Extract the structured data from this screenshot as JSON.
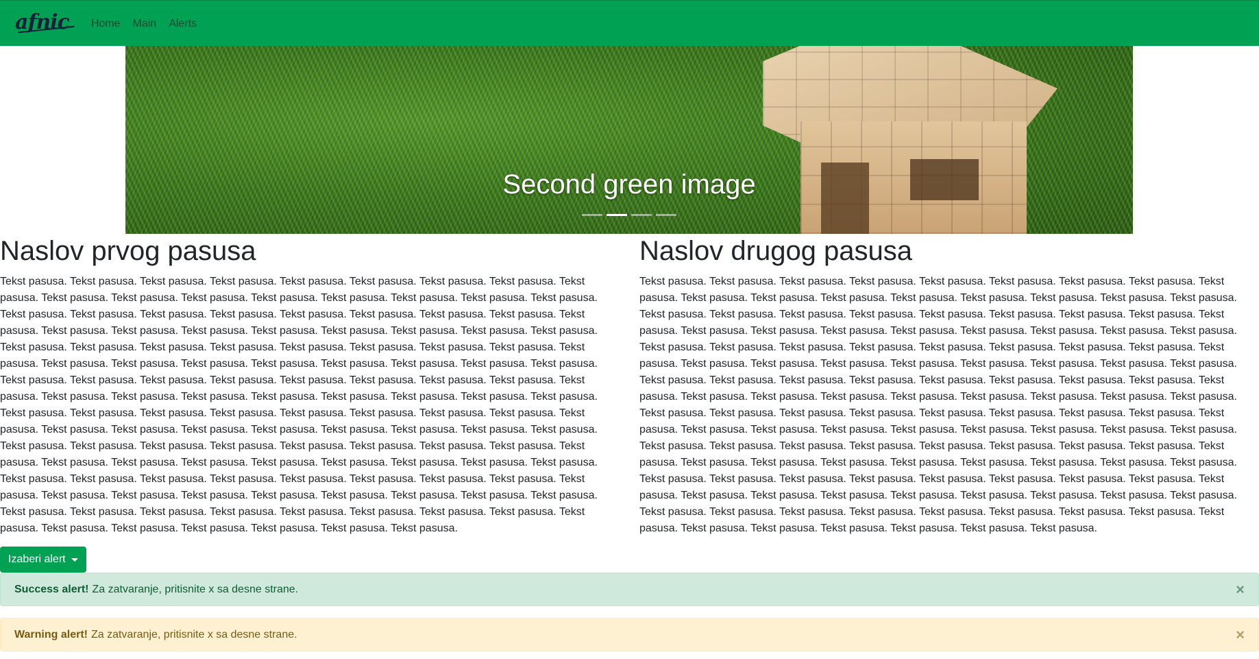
{
  "navbar": {
    "bg_color": "#00a152",
    "brand": "afnic",
    "links": [
      "Home",
      "Main",
      "Alerts"
    ]
  },
  "carousel": {
    "caption": "Second green image",
    "indicator_count": 4,
    "active_index": 1
  },
  "articles": [
    {
      "title": "Naslov prvog pasusa",
      "text": "Tekst pasusa. Tekst pasusa. Tekst pasusa. Tekst pasusa. Tekst pasusa. Tekst pasusa. Tekst pasusa. Tekst pasusa. Tekst pasusa. Tekst pasusa. Tekst pasusa. Tekst pasusa. Tekst pasusa. Tekst pasusa. Tekst pasusa. Tekst pasusa. Tekst pasusa. Tekst pasusa. Tekst pasusa. Tekst pasusa. Tekst pasusa. Tekst pasusa. Tekst pasusa. Tekst pasusa. Tekst pasusa. Tekst pasusa. Tekst pasusa. Tekst pasusa. Tekst pasusa. Tekst pasusa. Tekst pasusa. Tekst pasusa. Tekst pasusa. Tekst pasusa. Tekst pasusa. Tekst pasusa. Tekst pasusa. Tekst pasusa. Tekst pasusa. Tekst pasusa. Tekst pasusa. Tekst pasusa. Tekst pasusa. Tekst pasusa. Tekst pasusa. Tekst pasusa. Tekst pasusa. Tekst pasusa. Tekst pasusa. Tekst pasusa. Tekst pasusa. Tekst pasusa. Tekst pasusa. Tekst pasusa. Tekst pasusa. Tekst pasusa. Tekst pasusa. Tekst pasusa. Tekst pasusa. Tekst pasusa. Tekst pasusa. Tekst pasusa. Tekst pasusa. Tekst pasusa. Tekst pasusa. Tekst pasusa. Tekst pasusa. Tekst pasusa. Tekst pasusa. Tekst pasusa. Tekst pasusa. Tekst pasusa. Tekst pasusa. Tekst pasusa. Tekst pasusa. Tekst pasusa. Tekst pasusa. Tekst pasusa. Tekst pasusa. Tekst pasusa. Tekst pasusa. Tekst pasusa. Tekst pasusa. Tekst pasusa. Tekst pasusa. Tekst pasusa. Tekst pasusa. Tekst pasusa. Tekst pasusa. Tekst pasusa. Tekst pasusa. Tekst pasusa. Tekst pasusa. Tekst pasusa. Tekst pasusa. Tekst pasusa. Tekst pasusa. Tekst pasusa. Tekst pasusa. Tekst pasusa. Tekst pasusa. Tekst pasusa. Tekst pasusa. Tekst pasusa. Tekst pasusa. Tekst pasusa. Tekst pasusa. Tekst pasusa. Tekst pasusa. Tekst pasusa. Tekst pasusa. Tekst pasusa. Tekst pasusa. Tekst pasusa. Tekst pasusa. Tekst pasusa. Tekst pasusa. Tekst pasusa. Tekst pasusa. Tekst pasusa. Tekst pasusa. Tekst pasusa. Tekst pasusa. Tekst pasusa. Tekst pasusa. Tekst pasusa. Tekst pasusa. Tekst pasusa. Tekst pasusa. Tekst pasusa. Tekst pasusa. Tekst pasusa. Tekst pasusa. Tekst pasusa."
    },
    {
      "title": "Naslov drugog pasusa",
      "text": "Tekst pasusa. Tekst pasusa. Tekst pasusa. Tekst pasusa. Tekst pasusa. Tekst pasusa. Tekst pasusa. Tekst pasusa. Tekst pasusa. Tekst pasusa. Tekst pasusa. Tekst pasusa. Tekst pasusa. Tekst pasusa. Tekst pasusa. Tekst pasusa. Tekst pasusa. Tekst pasusa. Tekst pasusa. Tekst pasusa. Tekst pasusa. Tekst pasusa. Tekst pasusa. Tekst pasusa. Tekst pasusa. Tekst pasusa. Tekst pasusa. Tekst pasusa. Tekst pasusa. Tekst pasusa. Tekst pasusa. Tekst pasusa. Tekst pasusa. Tekst pasusa. Tekst pasusa. Tekst pasusa. Tekst pasusa. Tekst pasusa. Tekst pasusa. Tekst pasusa. Tekst pasusa. Tekst pasusa. Tekst pasusa. Tekst pasusa. Tekst pasusa. Tekst pasusa. Tekst pasusa. Tekst pasusa. Tekst pasusa. Tekst pasusa. Tekst pasusa. Tekst pasusa. Tekst pasusa. Tekst pasusa. Tekst pasusa. Tekst pasusa. Tekst pasusa. Tekst pasusa. Tekst pasusa. Tekst pasusa. Tekst pasusa. Tekst pasusa. Tekst pasusa. Tekst pasusa. Tekst pasusa. Tekst pasusa. Tekst pasusa. Tekst pasusa. Tekst pasusa. Tekst pasusa. Tekst pasusa. Tekst pasusa. Tekst pasusa. Tekst pasusa. Tekst pasusa. Tekst pasusa. Tekst pasusa. Tekst pasusa. Tekst pasusa. Tekst pasusa. Tekst pasusa. Tekst pasusa. Tekst pasusa. Tekst pasusa. Tekst pasusa. Tekst pasusa. Tekst pasusa. Tekst pasusa. Tekst pasusa. Tekst pasusa. Tekst pasusa. Tekst pasusa. Tekst pasusa. Tekst pasusa. Tekst pasusa. Tekst pasusa. Tekst pasusa. Tekst pasusa. Tekst pasusa. Tekst pasusa. Tekst pasusa. Tekst pasusa. Tekst pasusa. Tekst pasusa. Tekst pasusa. Tekst pasusa. Tekst pasusa. Tekst pasusa. Tekst pasusa. Tekst pasusa. Tekst pasusa. Tekst pasusa. Tekst pasusa. Tekst pasusa. Tekst pasusa. Tekst pasusa. Tekst pasusa. Tekst pasusa. Tekst pasusa. Tekst pasusa. Tekst pasusa. Tekst pasusa. Tekst pasusa. Tekst pasusa. Tekst pasusa. Tekst pasusa. Tekst pasusa. Tekst pasusa. Tekst pasusa. Tekst pasusa. Tekst pasusa. Tekst pasusa. Tekst pasusa. Tekst pasusa."
    }
  ],
  "dropdown": {
    "label": "Izaberi alert",
    "icon": "caret-down-icon",
    "bg_color": "#00a152"
  },
  "alerts": [
    {
      "type": "success",
      "strong": "Success alert!",
      "message": "Za zatvaranje, pritisnite x sa desne strane.",
      "close": "×",
      "bg_color": "#cfeadc"
    },
    {
      "type": "warning",
      "strong": "Warning alert!",
      "message": "Za zatvaranje, pritisnite x sa desne strane.",
      "close": "×",
      "bg_color": "#fdf1d1"
    }
  ]
}
